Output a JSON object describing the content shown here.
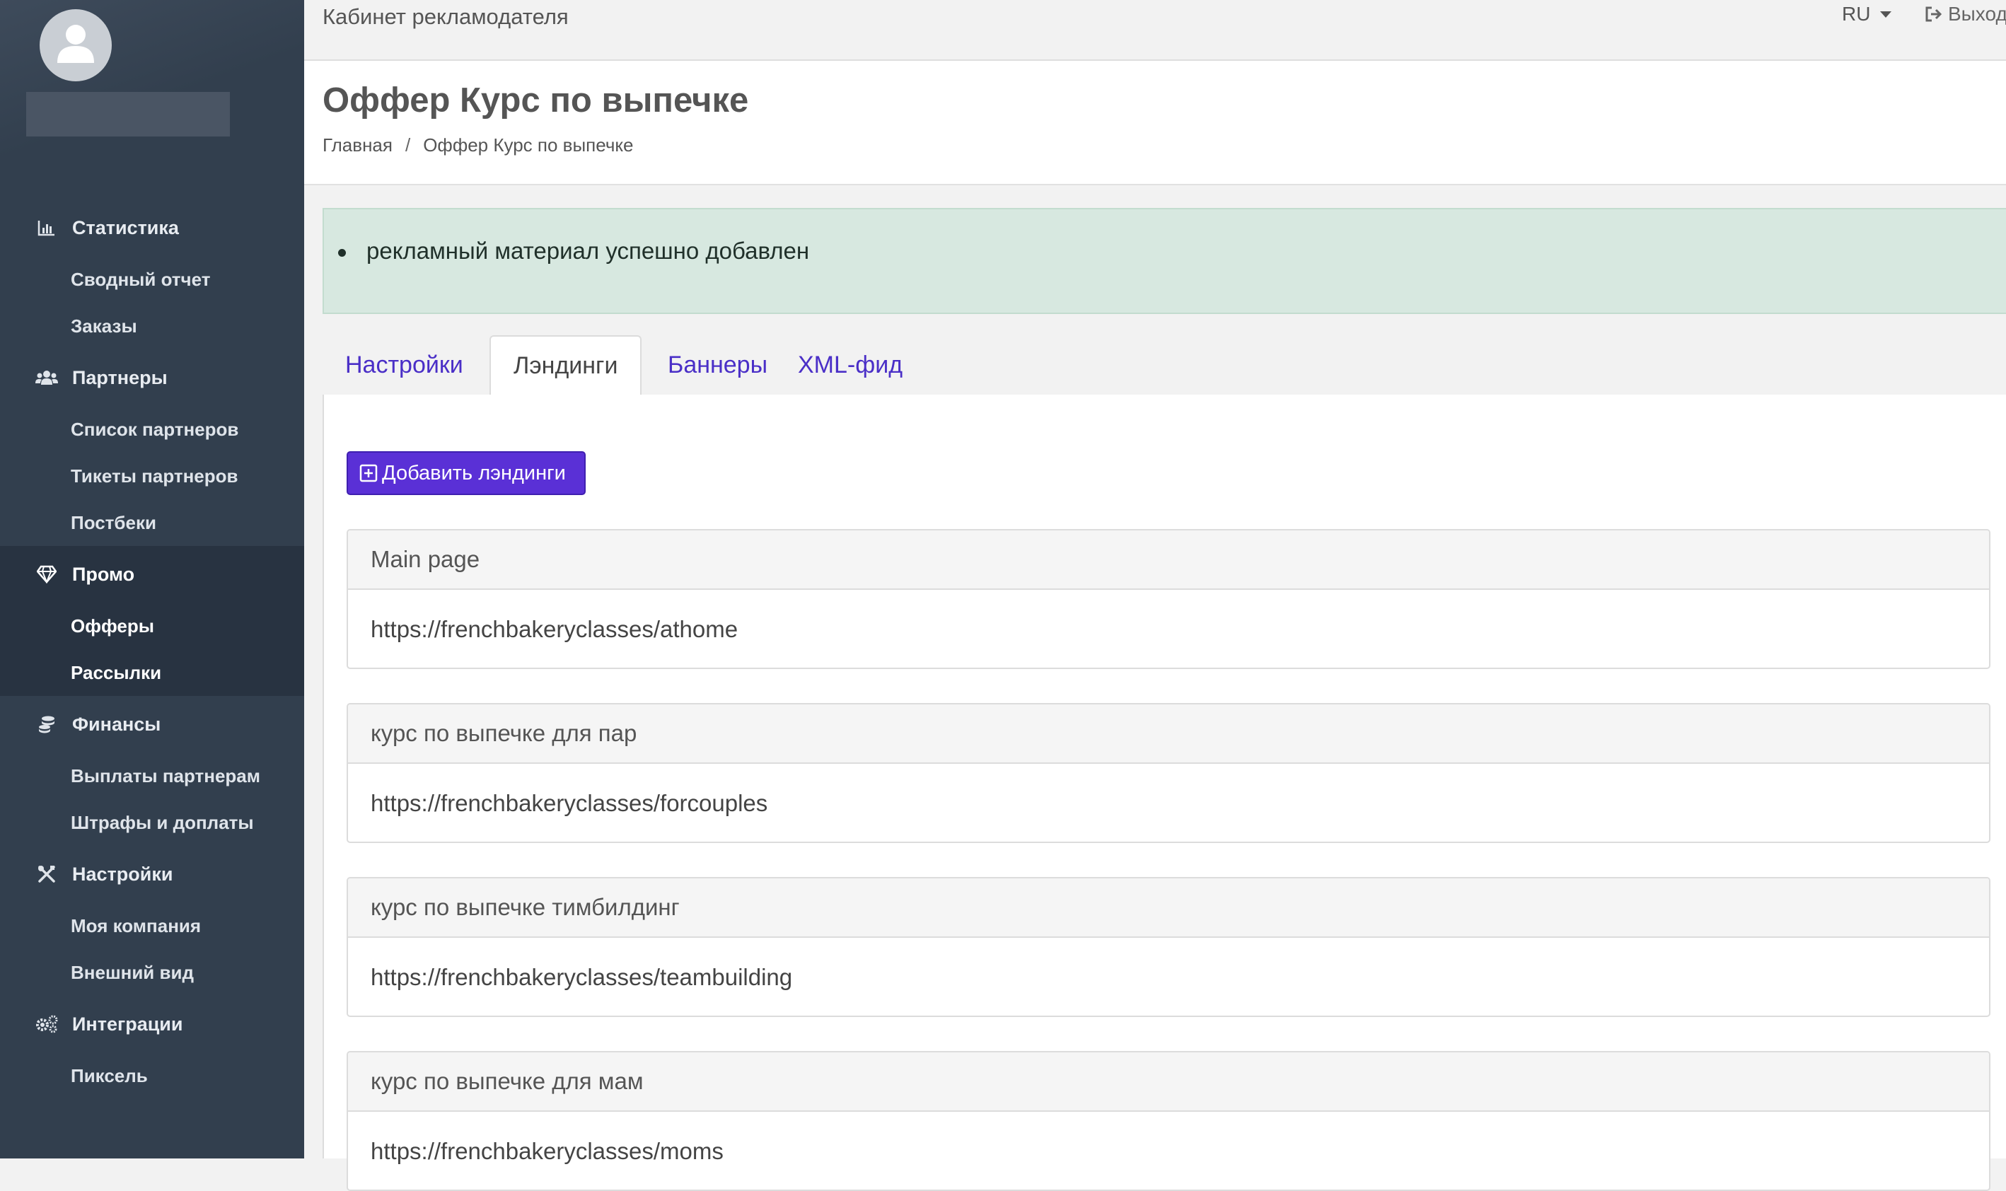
{
  "header": {
    "title": "Кабинет рекламодателя",
    "language": "RU",
    "logout_label": "Выход"
  },
  "sidebar": {
    "sections": [
      {
        "label": "Статистика",
        "icon": "chart-icon",
        "items": [
          "Сводный отчет",
          "Заказы"
        ]
      },
      {
        "label": "Партнеры",
        "icon": "users-icon",
        "items": [
          "Список партнеров",
          "Тикеты партнеров",
          "Постбеки"
        ]
      },
      {
        "label": "Промо",
        "icon": "diamond-icon",
        "items": [
          "Офферы",
          "Рассылки"
        ],
        "active": true
      },
      {
        "label": "Финансы",
        "icon": "coins-icon",
        "items": [
          "Выплаты партнерам",
          "Штрафы и доплаты"
        ]
      },
      {
        "label": "Настройки",
        "icon": "tools-icon",
        "items": [
          "Моя компания",
          "Внешний вид"
        ]
      },
      {
        "label": "Интеграции",
        "icon": "cogs-icon",
        "items": [
          "Пиксель"
        ]
      }
    ]
  },
  "page": {
    "title": "Оффер Курс по выпечке",
    "breadcrumb": [
      "Главная",
      "Оффер Курс по выпечке"
    ]
  },
  "alert": {
    "message": "рекламный материал успешно добавлен"
  },
  "tabs": [
    {
      "label": "Настройки",
      "active": false
    },
    {
      "label": "Лэндинги",
      "active": true
    },
    {
      "label": "Баннеры",
      "active": false
    },
    {
      "label": "XML-фид",
      "active": false
    }
  ],
  "landings": {
    "add_button_label": "Добавить лэндинги",
    "items": [
      {
        "name": "Main page",
        "url": "https://frenchbakeryclasses/athome"
      },
      {
        "name": "курс по выпечке для пар",
        "url": "https://frenchbakeryclasses/forcouples"
      },
      {
        "name": "курс по выпечке тимбилдинг",
        "url": "https://frenchbakeryclasses/teambuilding"
      },
      {
        "name": "курс по выпечке для мам",
        "url": "https://frenchbakeryclasses/moms"
      }
    ]
  },
  "colors": {
    "sidebar_bg": "#323f4e",
    "accent": "#5a30d6",
    "alert_bg": "#d7e8e0",
    "link": "#4a2fc7"
  }
}
